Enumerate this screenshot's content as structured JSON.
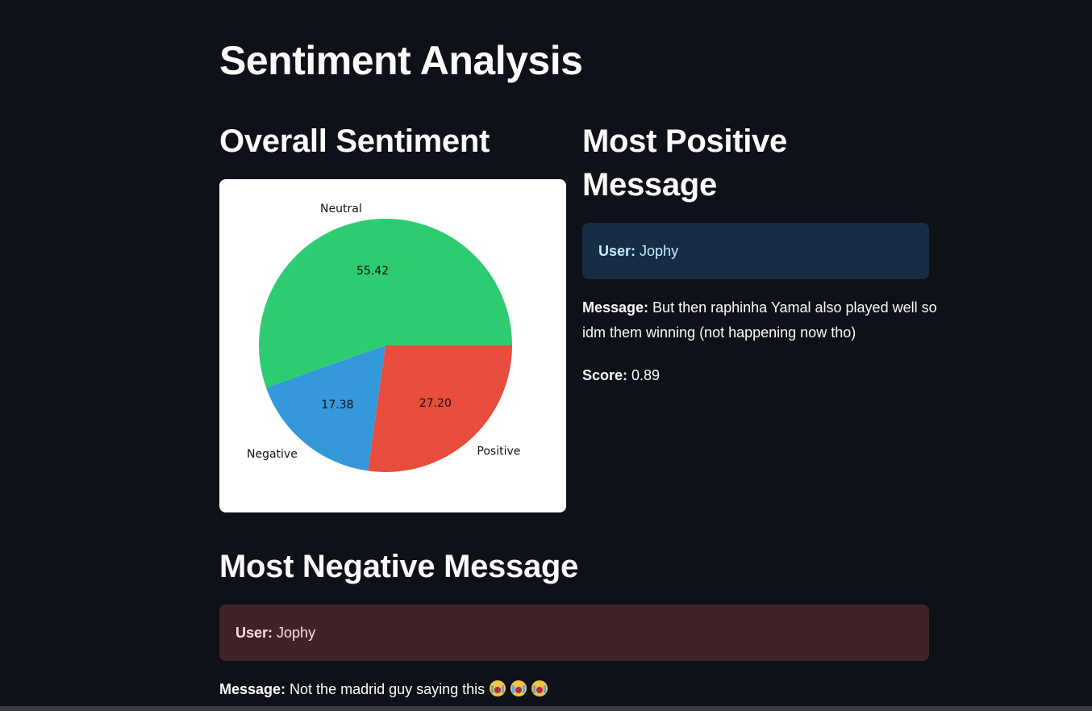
{
  "page": {
    "title": "Sentiment Analysis"
  },
  "overall": {
    "heading": "Overall Sentiment"
  },
  "most_positive": {
    "heading": "Most Positive Message",
    "user_label": "User:",
    "user": "Jophy",
    "message_label": "Message:",
    "message": "But then raphinha Yamal also played well so idm them winning (not happening now tho)",
    "score_label": "Score:",
    "score": "0.89"
  },
  "most_negative": {
    "heading": "Most Negative Message",
    "user_label": "User:",
    "user": "Jophy",
    "message_label": "Message:",
    "message": "Not the madrid guy saying this",
    "emoji_icons": [
      "loudly-crying-face-icon",
      "loudly-crying-face-icon",
      "loudly-crying-face-icon"
    ]
  },
  "colors": {
    "background": "#0e1117",
    "positive_box": "#172d43",
    "negative_box": "#3e2428"
  },
  "chart_data": {
    "type": "pie",
    "title": "",
    "categories": [
      "Neutral",
      "Negative",
      "Positive"
    ],
    "values": [
      55.42,
      17.38,
      27.2
    ],
    "value_labels": [
      "55.42",
      "17.38",
      "27.20"
    ],
    "colors": [
      "#2ecc71",
      "#3498db",
      "#e74c3c"
    ],
    "start_angle_deg": 0,
    "direction": "counterclockwise"
  }
}
